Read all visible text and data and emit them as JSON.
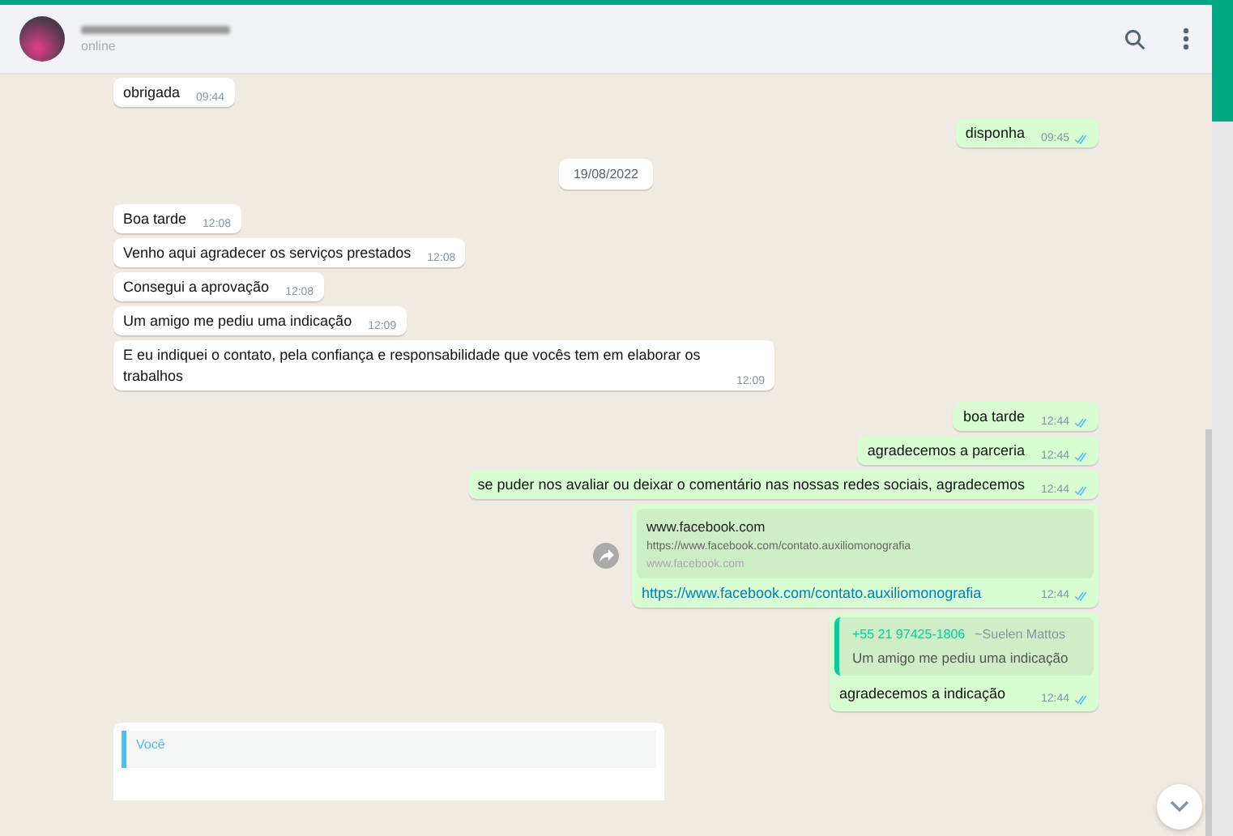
{
  "header": {
    "status": "online"
  },
  "messages": [
    {
      "kind": "in",
      "text": "obrigada",
      "time": "09:44"
    },
    {
      "kind": "out",
      "text": "disponha",
      "time": "09:45",
      "read": true
    },
    {
      "kind": "date",
      "text": "19/08/2022"
    },
    {
      "kind": "in",
      "text": "Boa tarde",
      "time": "12:08"
    },
    {
      "kind": "in",
      "text": "Venho aqui agradecer os serviços prestados",
      "time": "12:08"
    },
    {
      "kind": "in",
      "text": "Consegui a aprovação",
      "time": "12:08"
    },
    {
      "kind": "in",
      "text": "Um amigo me pediu uma indicação",
      "time": "12:09"
    },
    {
      "kind": "in",
      "text": "E eu indiquei o contato, pela confiança e responsabilidade que vocês tem em elaborar os trabalhos",
      "time": "12:09"
    },
    {
      "kind": "out",
      "text": "boa tarde",
      "time": "12:44",
      "read": true
    },
    {
      "kind": "out",
      "text": "agradecemos a parceria",
      "time": "12:44",
      "read": true
    },
    {
      "kind": "out",
      "text": "se puder nos avaliar ou deixar o comentário nas nossas redes sociais, agradecemos",
      "time": "12:44",
      "read": true
    },
    {
      "kind": "link",
      "preview_title": "www.facebook.com",
      "preview_url": "https://www.facebook.com/contato.auxiliomonografia",
      "preview_domain": "www.facebook.com",
      "text": "https://www.facebook.com/contato.auxiliomonografia",
      "time": "12:44",
      "read": true
    },
    {
      "kind": "quote",
      "quote_author": "+55 21 97425-1806",
      "quote_name": "~Suelen Mattos",
      "quote_text": "Um amigo me pediu uma indicação",
      "text": "agradecemos a indicação",
      "time": "12:44",
      "read": true
    },
    {
      "kind": "reply",
      "quote_author": "Você"
    }
  ]
}
